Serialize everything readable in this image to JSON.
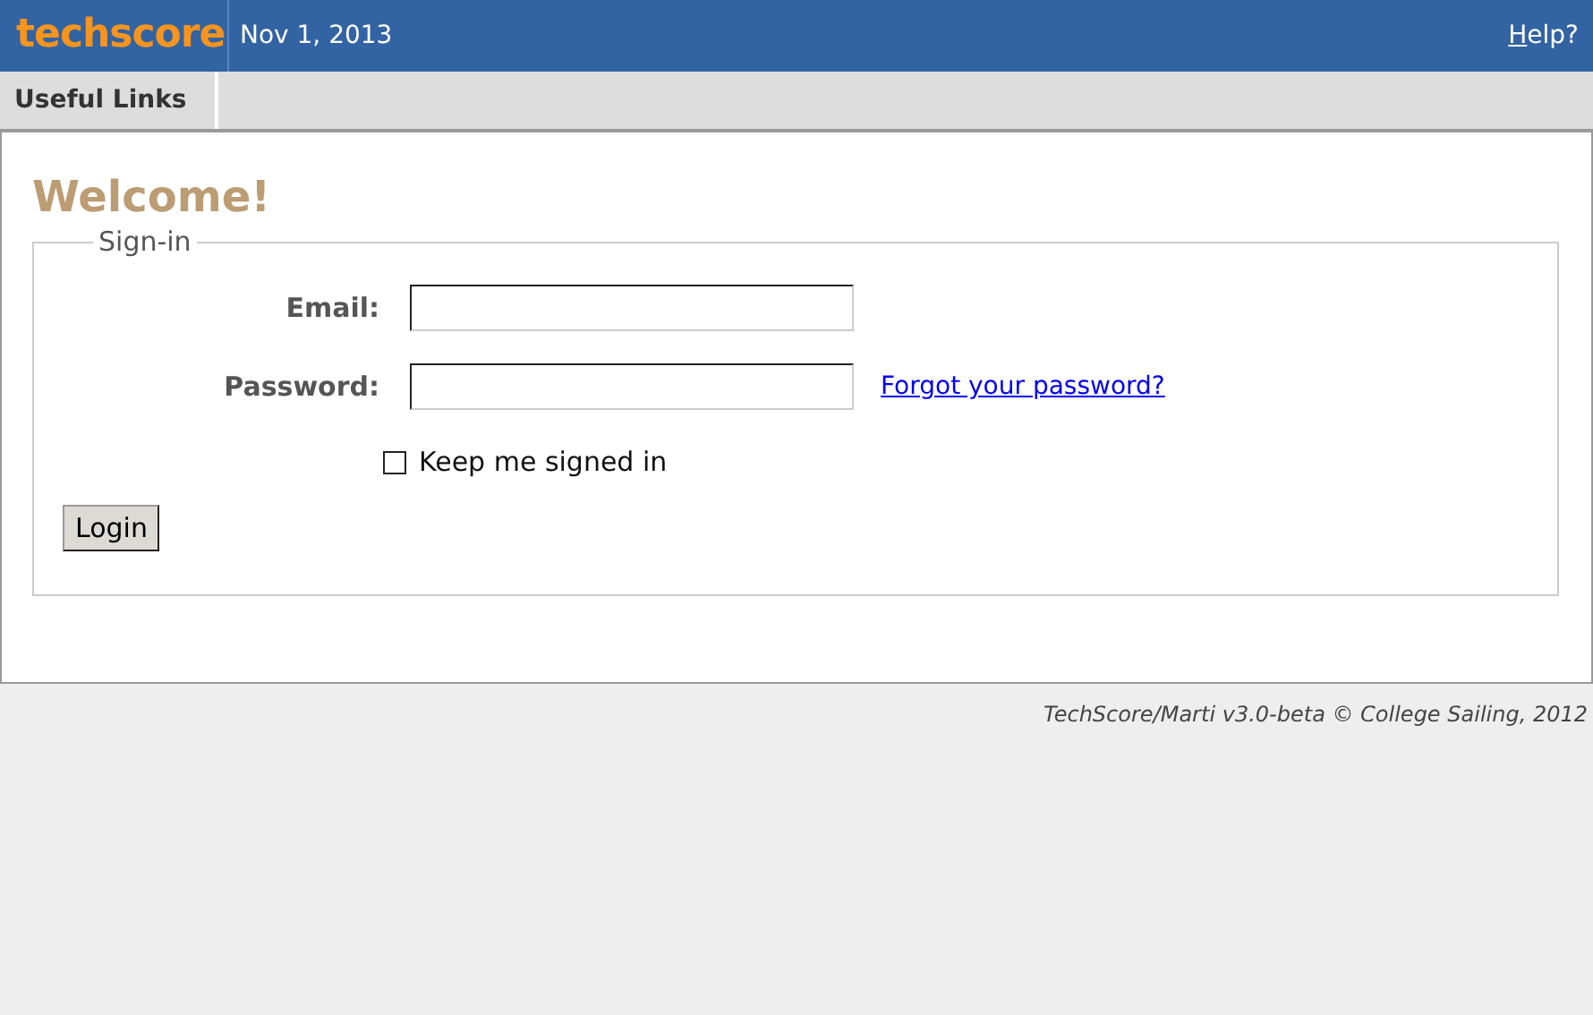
{
  "header": {
    "logo": "techscore",
    "date": "Nov 1, 2013",
    "help": {
      "label": "Help?"
    }
  },
  "menu": [
    {
      "label": "Useful Links"
    }
  ],
  "title": "Welcome!",
  "signin": {
    "legend": "Sign-in",
    "fields": [
      {
        "label": "Email:"
      },
      {
        "label": "Password:",
        "link": "Forgot your password?"
      }
    ],
    "remember": {
      "label": "Keep me signed in",
      "checked": false
    },
    "button": "Login"
  },
  "footer": "TechScore/Marti v3.0-beta © College Sailing, 2012"
}
